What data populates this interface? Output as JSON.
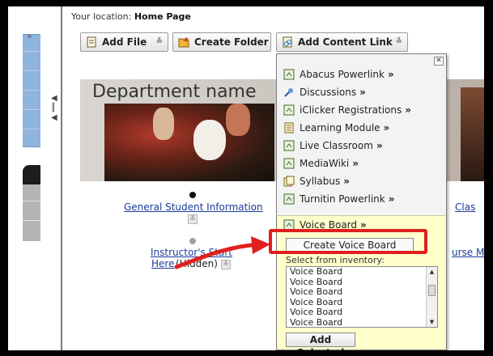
{
  "breadcrumb": {
    "prefix": "Your location:",
    "current": "Home Page"
  },
  "toolbar": {
    "add_file": "Add File",
    "create_folder": "Create Folder",
    "add_content_link": "Add Content Link"
  },
  "banner": {
    "title": "Department name"
  },
  "content": {
    "general_link": "General Student Information",
    "instructor_link_line1": "Instructor's Start",
    "instructor_link_line2": "Here",
    "hidden_label": "(Hidden)",
    "right_link_1": "Clas",
    "right_link_2": "urse M"
  },
  "menu": {
    "items": [
      {
        "label": "Abacus Powerlink",
        "arrow": "»",
        "icon": "tool-icon"
      },
      {
        "label": "Discussions",
        "arrow": "»",
        "icon": "pin-icon"
      },
      {
        "label": "iClicker Registrations",
        "arrow": "»",
        "icon": "tool-icon"
      },
      {
        "label": "Learning Module",
        "arrow": "»",
        "icon": "module-icon"
      },
      {
        "label": "Live Classroom",
        "arrow": "»",
        "icon": "tool-icon"
      },
      {
        "label": "MediaWiki",
        "arrow": "»",
        "icon": "tool-icon"
      },
      {
        "label": "Syllabus",
        "arrow": "»",
        "icon": "syllabus-icon"
      },
      {
        "label": "Turnitin Powerlink",
        "arrow": "»",
        "icon": "tool-icon"
      },
      {
        "label": "Voice Board",
        "arrow": "»",
        "icon": "tool-icon"
      }
    ],
    "create_button": "Create Voice Board",
    "inventory_label": "Select from inventory:",
    "inventory_options": [
      "Voice Board",
      "Voice Board",
      "Voice Board",
      "Voice Board",
      "Voice Board",
      "Voice Board"
    ],
    "add_selected": "Add Selected",
    "close": "✕"
  },
  "colors": {
    "highlight": "#e0201e",
    "link": "#1a3c9a",
    "panel": "#ffffcc"
  }
}
